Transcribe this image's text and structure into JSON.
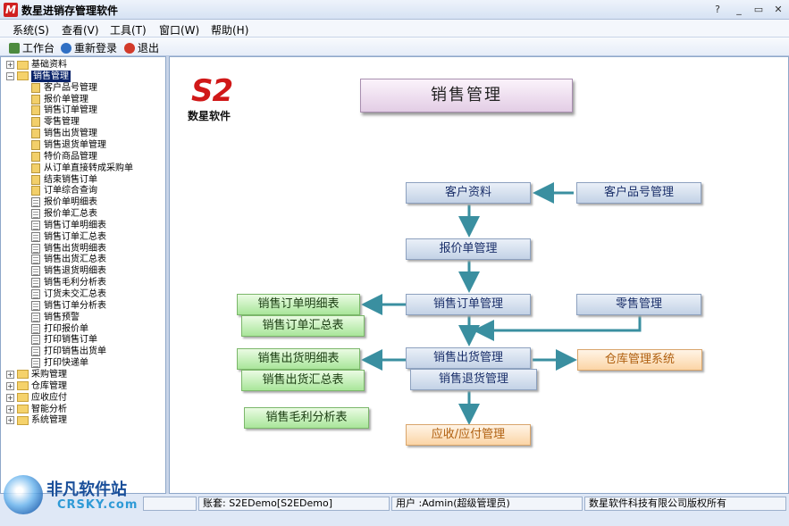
{
  "window": {
    "title": "数星进销存管理软件",
    "icon_letter": "M",
    "buttons": [
      "?",
      "_",
      "▭",
      "✕"
    ]
  },
  "menu": [
    "系统(S)",
    "查看(V)",
    "工具(T)",
    "窗口(W)",
    "帮助(H)"
  ],
  "toolbar": {
    "workbench": "工作台",
    "relogin": "重新登录",
    "exit": "退出"
  },
  "tree": {
    "top": [
      {
        "label": "基础资料",
        "expanded": false
      },
      {
        "label": "销售管理",
        "expanded": true,
        "selected": true
      }
    ],
    "sales_children": [
      {
        "label": "客户品号管理",
        "type": "form"
      },
      {
        "label": "报价单管理",
        "type": "form"
      },
      {
        "label": "销售订单管理",
        "type": "form"
      },
      {
        "label": "零售管理",
        "type": "form"
      },
      {
        "label": "销售出货管理",
        "type": "form"
      },
      {
        "label": "销售退货单管理",
        "type": "form"
      },
      {
        "label": "特价商品管理",
        "type": "form"
      },
      {
        "label": "从订单直接转成采购单",
        "type": "form"
      },
      {
        "label": "结束销售订单",
        "type": "form"
      },
      {
        "label": "订单综合查询",
        "type": "form"
      },
      {
        "label": "报价单明细表",
        "type": "report"
      },
      {
        "label": "报价单汇总表",
        "type": "report"
      },
      {
        "label": "销售订单明细表",
        "type": "report"
      },
      {
        "label": "销售订单汇总表",
        "type": "report"
      },
      {
        "label": "销售出货明细表",
        "type": "report"
      },
      {
        "label": "销售出货汇总表",
        "type": "report"
      },
      {
        "label": "销售退货明细表",
        "type": "report"
      },
      {
        "label": "销售毛利分析表",
        "type": "report"
      },
      {
        "label": "订货未交汇总表",
        "type": "report"
      },
      {
        "label": "销售订单分析表",
        "type": "report"
      },
      {
        "label": "销售预警",
        "type": "report"
      },
      {
        "label": "打印报价单",
        "type": "report"
      },
      {
        "label": "打印销售订单",
        "type": "report"
      },
      {
        "label": "打印销售出货单",
        "type": "report"
      },
      {
        "label": "打印快递单",
        "type": "report"
      }
    ],
    "bottom": [
      {
        "label": "采购管理"
      },
      {
        "label": "仓库管理"
      },
      {
        "label": "应收应付"
      },
      {
        "label": "智能分析"
      },
      {
        "label": "系统管理"
      }
    ]
  },
  "main": {
    "logo": "S2",
    "logo_sub": "数星软件",
    "title": "销售管理",
    "boxes": {
      "customer": "客户资料",
      "customer_part": "客户品号管理",
      "quote": "报价单管理",
      "order": "销售订单管理",
      "retail": "零售管理",
      "order_detail": "销售订单明细表",
      "order_summary": "销售订单汇总表",
      "ship": "销售出货管理",
      "ship_detail": "销售出货明细表",
      "ship_summary": "销售出货汇总表",
      "warehouse": "仓库管理系统",
      "return": "销售退货管理",
      "profit": "销售毛利分析表",
      "ar_ap": "应收/应付管理"
    }
  },
  "status": {
    "account": "账套:  S2EDemo[S2EDemo]",
    "user": "用户 :Admin(超级管理员)",
    "copyright": "数星软件科技有限公司版权所有"
  },
  "watermark": {
    "line1": "非凡软件站",
    "line2": "CRSKY.com"
  },
  "colors": {
    "arrow": "#3a8fa0",
    "blue_box": "#c3d2e6",
    "green_box": "#a9e69a",
    "orange_box": "#fbd5a6",
    "logo_red": "#d01818"
  }
}
